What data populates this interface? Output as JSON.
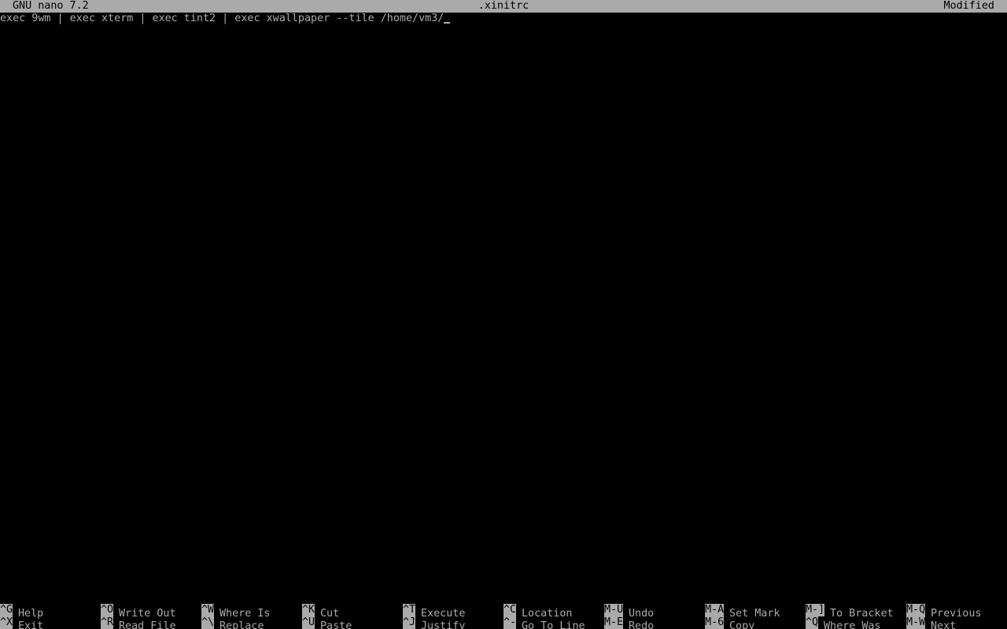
{
  "titlebar": {
    "app": "GNU nano 7.2",
    "filename": ".xinitrc",
    "status": "Modified"
  },
  "editor": {
    "lines": [
      "exec 9wm | exec xterm | exec tint2 | exec xwallpaper --tile /home/vm3/"
    ]
  },
  "shortcuts": {
    "row1": [
      {
        "key": "^G",
        "label": "Help"
      },
      {
        "key": "^O",
        "label": "Write Out"
      },
      {
        "key": "^W",
        "label": "Where Is"
      },
      {
        "key": "^K",
        "label": "Cut"
      },
      {
        "key": "^T",
        "label": "Execute"
      },
      {
        "key": "^C",
        "label": "Location"
      },
      {
        "key": "M-U",
        "label": "Undo"
      },
      {
        "key": "M-A",
        "label": "Set Mark"
      },
      {
        "key": "M-]",
        "label": "To Bracket"
      },
      {
        "key": "M-Q",
        "label": "Previous"
      }
    ],
    "row2": [
      {
        "key": "^X",
        "label": "Exit"
      },
      {
        "key": "^R",
        "label": "Read File"
      },
      {
        "key": "^\\",
        "label": "Replace"
      },
      {
        "key": "^U",
        "label": "Paste"
      },
      {
        "key": "^J",
        "label": "Justify"
      },
      {
        "key": "^-",
        "label": "Go To Line"
      },
      {
        "key": "M-E",
        "label": "Redo"
      },
      {
        "key": "M-6",
        "label": "Copy"
      },
      {
        "key": "^Q",
        "label": "Where Was"
      },
      {
        "key": "M-W",
        "label": "Next"
      }
    ]
  },
  "colors": {
    "background": "#000000",
    "foreground": "#aaaaaa",
    "inverse_bg": "#aaaaaa",
    "inverse_fg": "#000000"
  }
}
